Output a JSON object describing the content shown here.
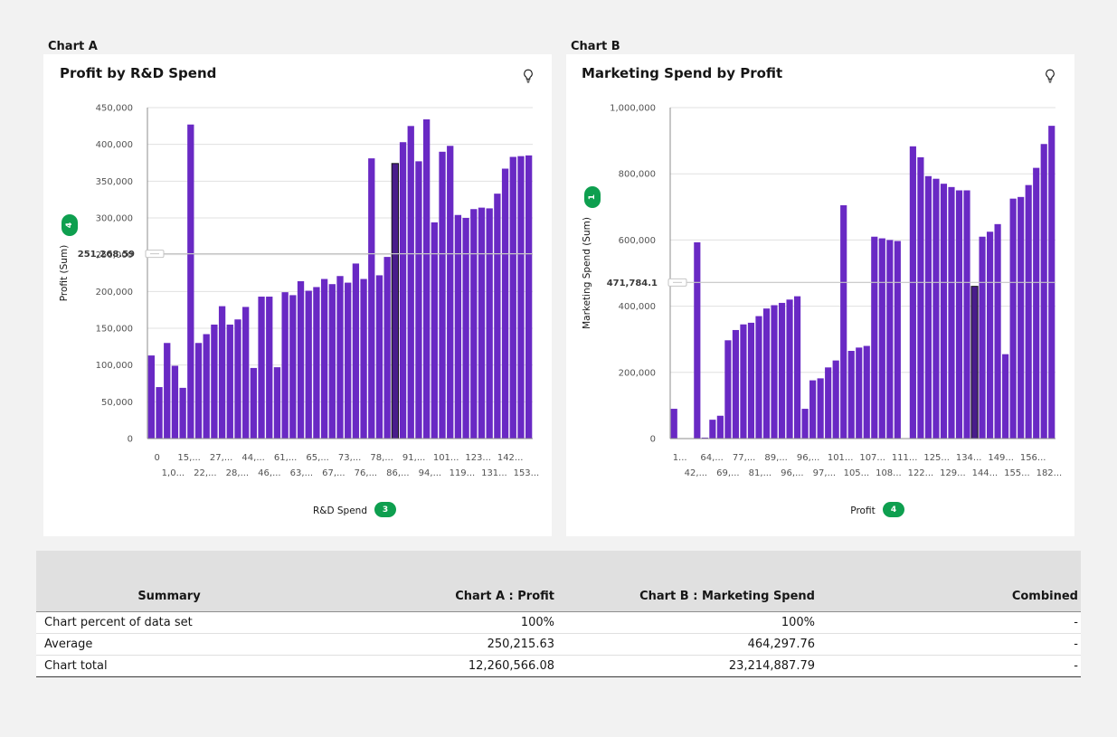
{
  "charts": [
    {
      "section_label": "Chart A",
      "title": "Profit by R&D Spend",
      "x_axis_title": "R&D Spend",
      "x_badge": "3",
      "y_axis_title": "Profit (Sum)",
      "y_badge": "4",
      "ref_label": "251,268.59",
      "icons": [
        "lightbulb-icon"
      ],
      "chart_data": {
        "type": "bar",
        "ylim": [
          0,
          450000
        ],
        "y_ticks": [
          "0",
          "50,000",
          "100,000",
          "150,000",
          "200,000",
          "250,000",
          "300,000",
          "350,000",
          "400,000",
          "450,000"
        ],
        "y_tick_values": [
          0,
          50000,
          100000,
          150000,
          200000,
          250000,
          300000,
          350000,
          400000,
          450000
        ],
        "x_tick_labels_top": [
          "0",
          "15,...",
          "27,...",
          "44,...",
          "61,...",
          "65,...",
          "73,...",
          "78,...",
          "91,...",
          "101...",
          "123...",
          "142..."
        ],
        "x_tick_labels_bottom": [
          "1,0...",
          "22,...",
          "28,...",
          "46,...",
          "63,...",
          "67,...",
          "76,...",
          "86,...",
          "94,...",
          "119...",
          "131...",
          "153..."
        ],
        "reference_value": 251268.59,
        "highlighted_index": 31,
        "grid": true,
        "values": [
          113000,
          70000,
          130000,
          99000,
          69000,
          427000,
          130000,
          142000,
          155000,
          180000,
          155000,
          162000,
          179000,
          96000,
          193000,
          193000,
          97000,
          199000,
          195000,
          214000,
          201000,
          206000,
          217000,
          210000,
          221000,
          212000,
          238000,
          217000,
          381000,
          222000,
          247000,
          374000,
          403000,
          425000,
          377000,
          434000,
          294000,
          390000,
          398000,
          304000,
          300000,
          312000,
          314000,
          313000,
          333000,
          367000,
          383000,
          384000,
          385000
        ]
      }
    },
    {
      "section_label": "Chart B",
      "title": "Marketing Spend by Profit",
      "x_axis_title": "Profit",
      "x_badge": "4",
      "y_axis_title": "Marketing Spend (Sum)",
      "y_badge": "1",
      "ref_label": "471,784.1",
      "icons": [
        "lightbulb-icon"
      ],
      "chart_data": {
        "type": "bar",
        "ylim": [
          0,
          1000000
        ],
        "y_ticks": [
          "0",
          "200,000",
          "400,000",
          "600,000",
          "800,000",
          "1,000,000"
        ],
        "y_tick_values": [
          0,
          200000,
          400000,
          600000,
          800000,
          1000000
        ],
        "x_tick_labels_top": [
          "1...",
          "64,...",
          "77,...",
          "89,...",
          "96,...",
          "101...",
          "107...",
          "111...",
          "125...",
          "134...",
          "149...",
          "156..."
        ],
        "x_tick_labels_bottom": [
          "42,...",
          "69,...",
          "81,...",
          "96,...",
          "97,...",
          "105...",
          "108...",
          "122...",
          "129...",
          "144...",
          "155...",
          "182..."
        ],
        "reference_value": 471784.1,
        "highlighted_index": 39,
        "grid": true,
        "values": [
          90000,
          0,
          0,
          593000,
          3000,
          57000,
          69000,
          297000,
          328000,
          345000,
          350000,
          370000,
          393000,
          403000,
          410000,
          420000,
          430000,
          90000,
          176000,
          182000,
          215000,
          236000,
          705000,
          265000,
          275000,
          280000,
          610000,
          605000,
          600000,
          597000,
          0,
          883000,
          850000,
          793000,
          785000,
          770000,
          760000,
          750000,
          750000,
          460000,
          610000,
          625000,
          648000,
          255000,
          725000,
          730000,
          766000,
          818000,
          890000,
          945000
        ]
      }
    }
  ],
  "summary": {
    "headers": [
      "Summary",
      "Chart A : Profit",
      "Chart B : Marketing Spend",
      "Combined"
    ],
    "rows": [
      [
        "Chart percent of data set",
        "100%",
        "100%",
        "-"
      ],
      [
        "Average",
        "250,215.63",
        "464,297.76",
        "-"
      ],
      [
        "Chart total",
        "12,260,566.08",
        "23,214,887.79",
        "-"
      ]
    ]
  },
  "colors": {
    "bar": "#6929c4",
    "bar_highlight": "#491d8b",
    "badge": "#0e9f4f",
    "gridline": "#e0e0e0",
    "reference_line": "#c6c6c6",
    "header_bg": "#e0e0e0"
  }
}
